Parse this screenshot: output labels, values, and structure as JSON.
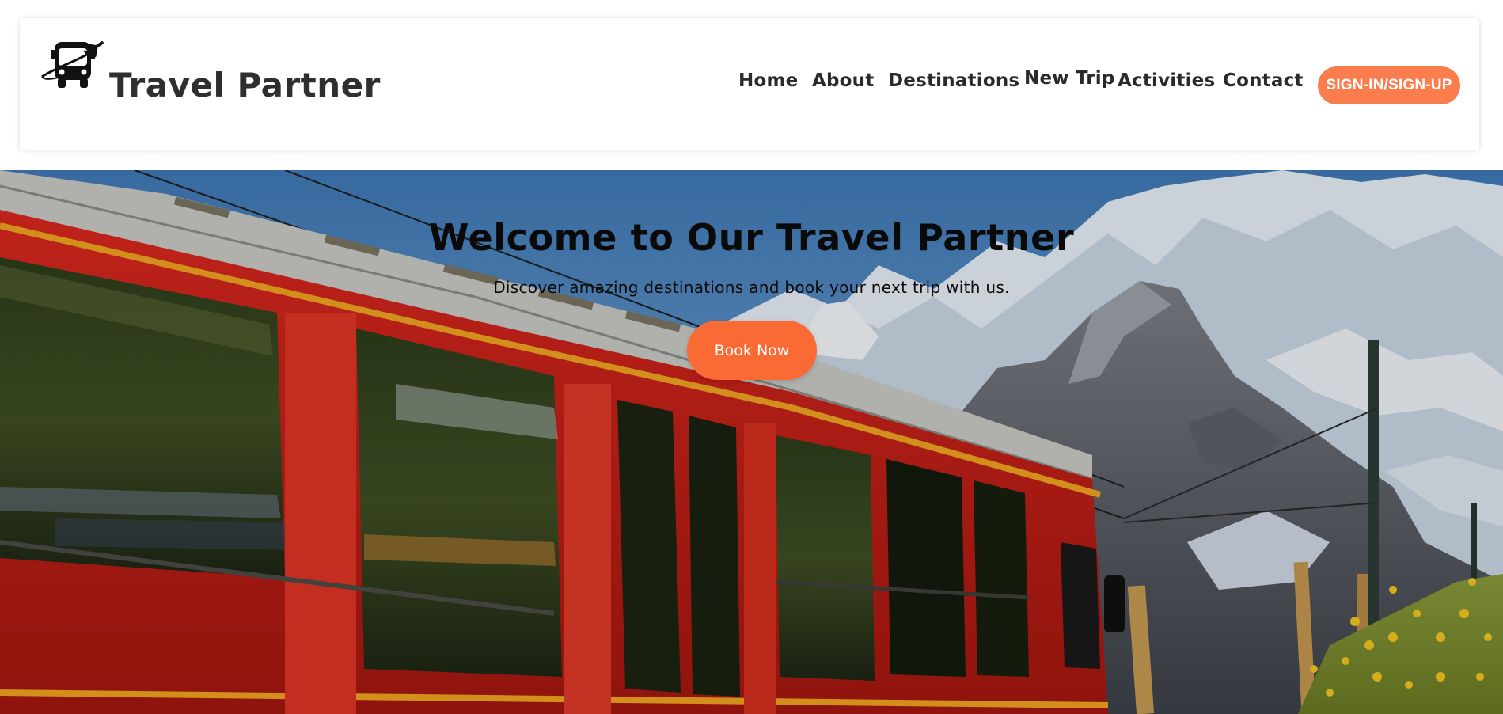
{
  "header": {
    "brand": "Travel Partner",
    "logo_icon": "bus-airplane-icon",
    "nav": {
      "home": "Home",
      "about": "About",
      "destinations": "Destinations",
      "new_trip": "New Trip",
      "activities": "Activities",
      "contact": "Contact"
    },
    "signin_label": "SIGN-IN/SIGN-UP"
  },
  "hero": {
    "title": "Welcome to Our Travel Partner",
    "subtitle": "Discover amazing destinations and book your next trip with us.",
    "cta_label": "Book Now"
  },
  "colors": {
    "accent": "#fb7d4e",
    "cta": "#fa6a34",
    "text_dark": "#2a2a2a"
  }
}
